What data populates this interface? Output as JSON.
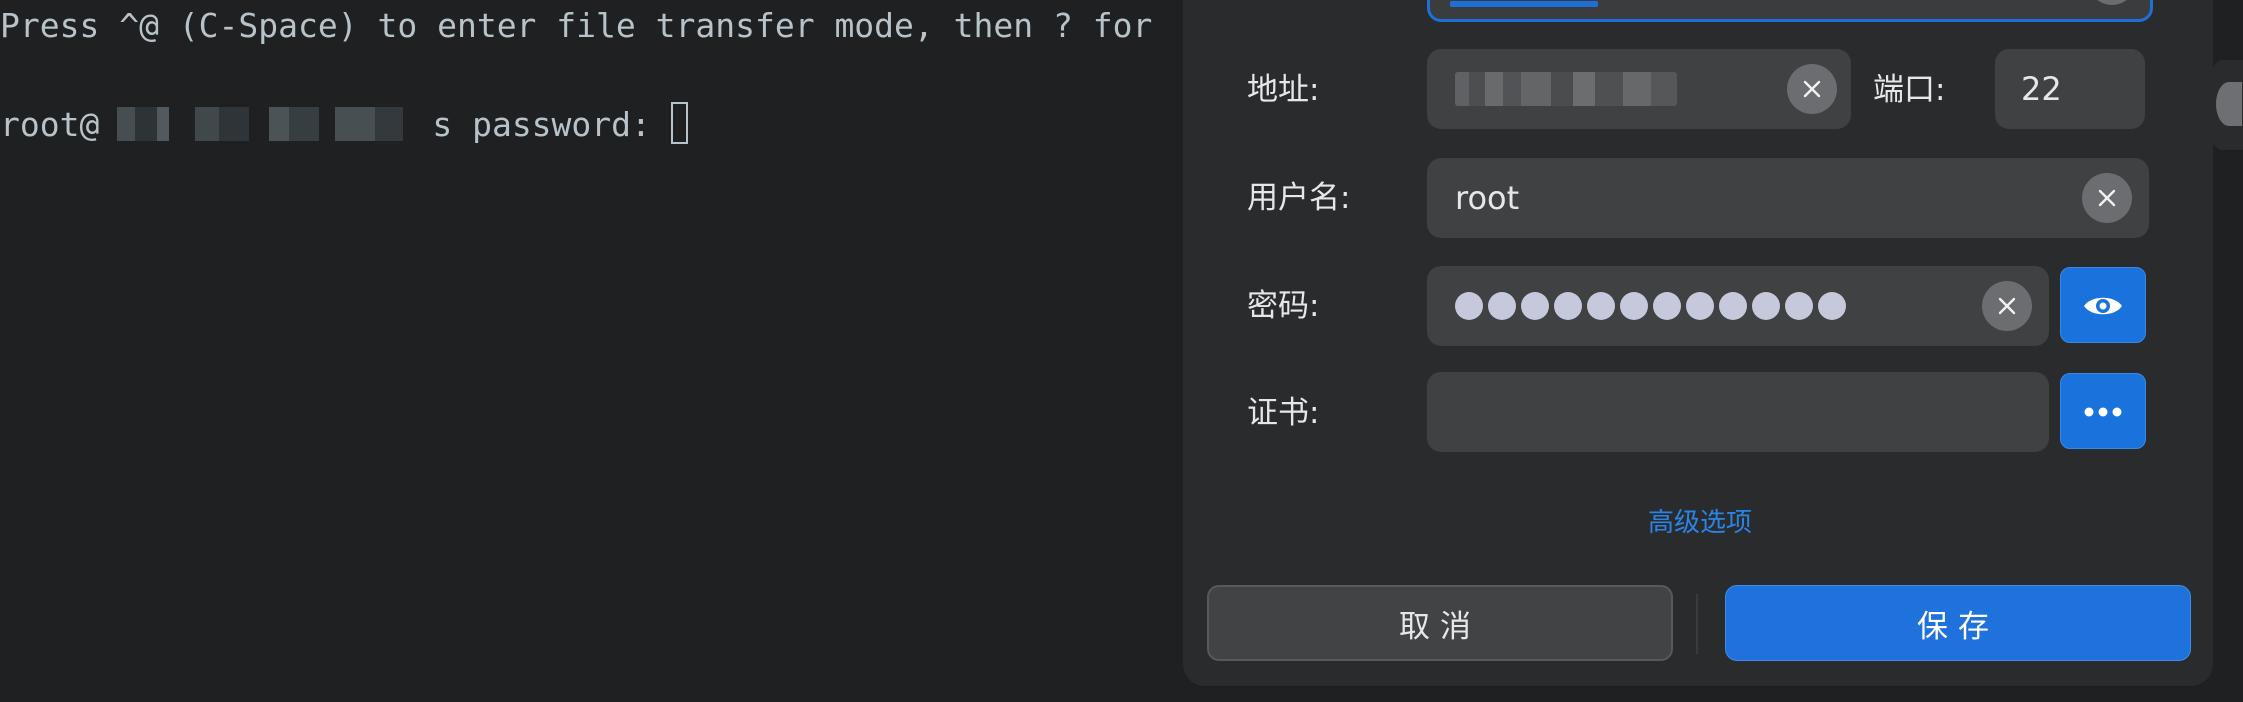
{
  "terminal": {
    "line1": "Press ^@ (C-Space) to enter file transfer mode, then ? for",
    "prompt_user": "root@",
    "prompt_suffix": "s password: "
  },
  "dialog": {
    "address": {
      "label": "地址:",
      "value": ""
    },
    "port": {
      "label": "端口:",
      "value": "22"
    },
    "username": {
      "label": "用户名:",
      "value": "root"
    },
    "password": {
      "label": "密码:",
      "masked_length": 12
    },
    "certificate": {
      "label": "证书:",
      "value": ""
    },
    "advanced_link": "高级选项",
    "cancel_label": "取消",
    "save_label": "保存"
  },
  "colors": {
    "accent": "#1f71dc",
    "link": "#2a84e8",
    "dialog_bg": "#2a2b2d",
    "field_bg": "#404143",
    "terminal_bg": "#1f2022"
  },
  "icons": {
    "clear": "close-icon",
    "reveal": "eye-icon",
    "browse": "ellipsis-icon"
  }
}
